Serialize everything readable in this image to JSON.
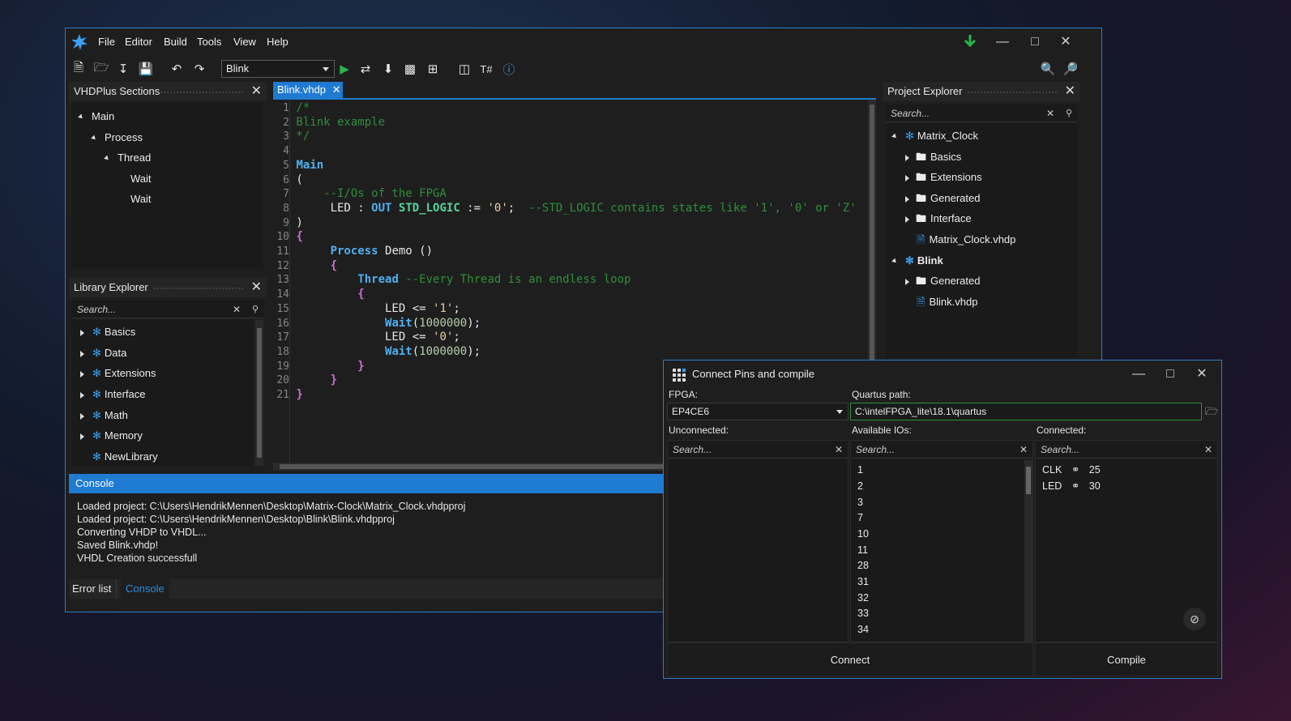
{
  "menu": [
    "File",
    "Editor",
    "Build",
    "Tools",
    "View",
    "Help"
  ],
  "toolbar": {
    "project_combo": "Blink"
  },
  "sections_panel": {
    "title": "VHDPlus Sections",
    "items": [
      "Main",
      "Process",
      "Thread",
      "Wait",
      "Wait"
    ]
  },
  "library_panel": {
    "title": "Library Explorer",
    "search_placeholder": "Search...",
    "items": [
      "Basics",
      "Data",
      "Extensions",
      "Interface",
      "Math",
      "Memory",
      "NewLibrary"
    ]
  },
  "editor": {
    "tab": "Blink.vhdp",
    "line_numbers": [
      "1",
      "2",
      "3",
      "4",
      "5",
      "6",
      "7",
      "8",
      "9",
      "10",
      "11",
      "12",
      "13",
      "14",
      "15",
      "16",
      "17",
      "18",
      "19",
      "20",
      "21"
    ]
  },
  "project_panel": {
    "title": "Project Explorer",
    "search_placeholder": "Search...",
    "items": [
      "Matrix_Clock",
      "Basics",
      "Extensions",
      "Generated",
      "Interface",
      "Matrix_Clock.vhdp",
      "Blink",
      "Generated",
      "Blink.vhdp"
    ]
  },
  "console": {
    "title": "Console",
    "lines": [
      "Loaded project: C:\\Users\\HendrikMennen\\Desktop\\Matrix-Clock\\Matrix_Clock.vhdpproj",
      "Loaded project: C:\\Users\\HendrikMennen\\Desktop\\Blink\\Blink.vhdpproj",
      "Converting VHDP to VHDL...",
      "Saved Blink.vhdp!",
      "VHDL Creation successfull"
    ],
    "tabs": [
      "Error list",
      "Console"
    ]
  },
  "dialog": {
    "title": "Connect Pins and compile",
    "fpga_label": "FPGA:",
    "fpga_value": "EP4CE6",
    "quartus_label": "Quartus path:",
    "quartus_value": "C:\\intelFPGA_lite\\18.1\\quartus",
    "unconnected_label": "Unconnected:",
    "available_label": "Available IOs:",
    "connected_label": "Connected:",
    "search_placeholder": "Search...",
    "available_ios": [
      "1",
      "2",
      "3",
      "7",
      "10",
      "11",
      "28",
      "31",
      "32",
      "33",
      "34"
    ],
    "connected": [
      {
        "signal": "CLK",
        "pin": "25"
      },
      {
        "signal": "LED",
        "pin": "30"
      }
    ],
    "connect_button": "Connect",
    "compile_button": "Compile"
  },
  "colors": {
    "accent": "#1f7ad1",
    "background": "#1e1e1e",
    "download_arrow": "#2bb34a"
  }
}
